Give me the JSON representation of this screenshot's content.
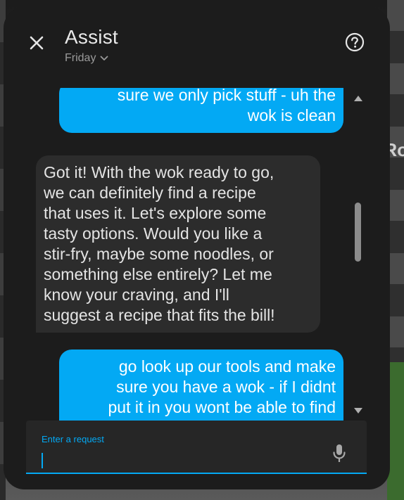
{
  "dialog": {
    "title": "Assist",
    "pipeline": "Friday"
  },
  "background": {
    "partial_text": "Ro"
  },
  "messages": [
    {
      "who": "user",
      "lines": [
        "sure we only pick stuff - uh the",
        "wok is clean"
      ]
    },
    {
      "who": "hass",
      "lines": [
        "Got it! With the wok ready to go,",
        "we can definitely find a recipe",
        "that uses it. Let's explore some",
        "tasty options. Would you like a",
        "stir-fry, maybe some noodles, or",
        "something else entirely? Let me",
        "know your craving, and I'll",
        "suggest a recipe that fits the bill!"
      ]
    },
    {
      "who": "user",
      "lines": [
        "go look up our tools and make",
        "sure you have a wok - if I didnt",
        "put it in you wont be able to find",
        "***"
      ]
    }
  ],
  "input": {
    "label": "Enter a request",
    "value": ""
  },
  "icons": {
    "close": "close-icon",
    "help": "help-circle-icon",
    "chevron": "chevron-down-icon",
    "mic": "microphone-icon"
  },
  "colors": {
    "accent": "#03a9f4",
    "user_bubble": "#03a9f4",
    "assistant_bubble": "#2c2c2c",
    "dialog_bg": "#1c1c1c"
  }
}
